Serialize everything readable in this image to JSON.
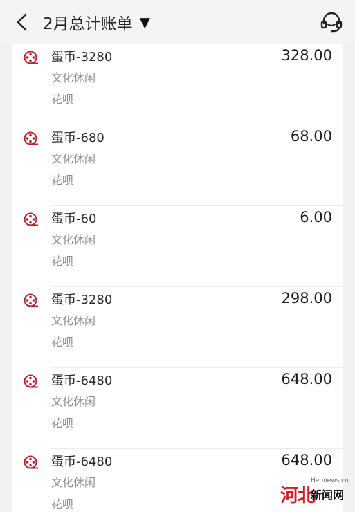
{
  "header": {
    "title": "2月总计账单",
    "dropdown_glyph": "▼",
    "back_icon": "chevron-left-icon",
    "support_icon": "customer-service-headset-icon"
  },
  "colors": {
    "accent_red": "#b8212c",
    "watermark_red": "#d71920"
  },
  "bills": [
    {
      "name": "蛋币-3280",
      "category": "文化休闲",
      "payment": "花呗",
      "amount": "328.00"
    },
    {
      "name": "蛋币-680",
      "category": "文化休闲",
      "payment": "花呗",
      "amount": "68.00"
    },
    {
      "name": "蛋币-60",
      "category": "文化休闲",
      "payment": "花呗",
      "amount": "6.00"
    },
    {
      "name": "蛋币-3280",
      "category": "文化休闲",
      "payment": "花呗",
      "amount": "298.00"
    },
    {
      "name": "蛋币-6480",
      "category": "文化休闲",
      "payment": "花呗",
      "amount": "648.00"
    },
    {
      "name": "蛋币-6480",
      "category": "文化休闲",
      "payment": "花呗",
      "amount": "648.00"
    }
  ],
  "watermark": {
    "logo_text": "河北",
    "site": "Hebnews.cn",
    "name": "新闻网"
  }
}
